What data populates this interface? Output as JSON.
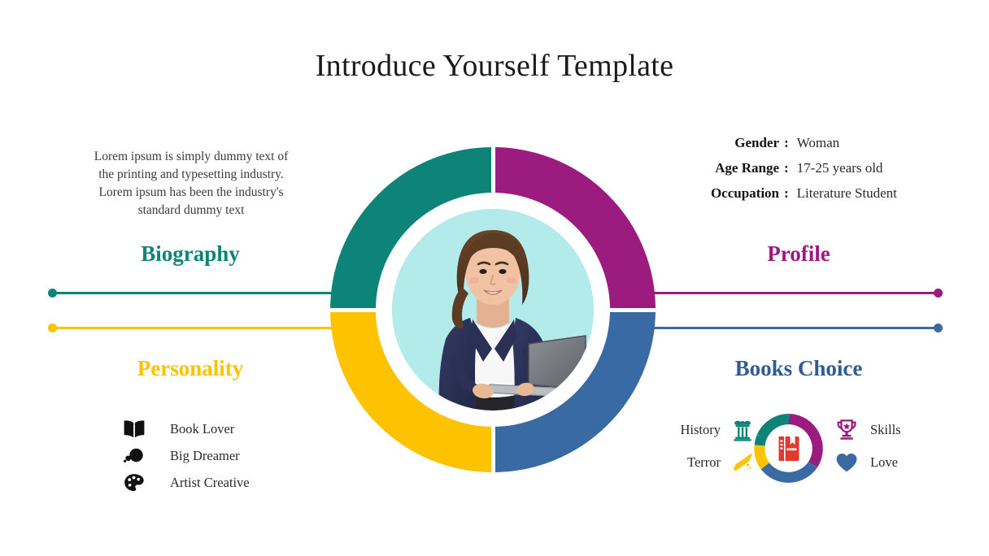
{
  "page": {
    "title": "Introduce Yourself Template",
    "background_color": "#ffffff"
  },
  "theme": {
    "teal": "#0e8479",
    "magenta": "#9b1b7e",
    "blue": "#3a6aa4",
    "blue_heading": "#2f5d93",
    "yellow": "#fdc300",
    "photo_background": "#b3eaea",
    "icon_black": "#111111",
    "book_red": "#e1392f"
  },
  "sections": {
    "biography": {
      "heading": "Biography",
      "color": "#0e8479",
      "body": "Lorem ipsum is simply dummy text of the printing and typesetting industry. Lorem ipsum has been the industry's standard dummy text"
    },
    "profile": {
      "heading": "Profile",
      "color": "#9b1b7e",
      "rows": [
        {
          "label": "Gender",
          "separator": ":",
          "value": "Woman"
        },
        {
          "label": "Age Range",
          "separator": ":",
          "value": "17-25 years old"
        },
        {
          "label": "Occupation",
          "separator": ":",
          "value": "Literature Student"
        }
      ]
    },
    "personality": {
      "heading": "Personality",
      "color": "#fdc300",
      "items": [
        {
          "label": "Book Lover",
          "icon": "open-book-icon"
        },
        {
          "label": "Big Dreamer",
          "icon": "thought-bubble-icon"
        },
        {
          "label": "Artist Creative",
          "icon": "artist-palette-icon"
        }
      ]
    },
    "books_choice": {
      "heading": "Books Choice",
      "color": "#2f5d93",
      "items": [
        {
          "label": "History",
          "icon": "greek-column-icon",
          "color": "#0e8479"
        },
        {
          "label": "Terror",
          "icon": "bloody-knife-icon",
          "color": "#fdc300"
        },
        {
          "label": "Skills",
          "icon": "trophy-icon",
          "color": "#9b1b7e"
        },
        {
          "label": "Love",
          "icon": "heart-icon",
          "color": "#3a6aa4"
        }
      ],
      "center_icon": "notebook-icon"
    }
  },
  "donut": {
    "segments": [
      {
        "name": "Biography",
        "position": "top-left",
        "color": "#0e8479"
      },
      {
        "name": "Profile",
        "position": "top-right",
        "color": "#9b1b7e"
      },
      {
        "name": "Books Choice",
        "position": "bottom-right",
        "color": "#3a6aa4"
      },
      {
        "name": "Personality",
        "position": "bottom-left",
        "color": "#fdc300"
      }
    ],
    "center_photo_alt": "Young woman in navy blazer holding a laptop"
  }
}
